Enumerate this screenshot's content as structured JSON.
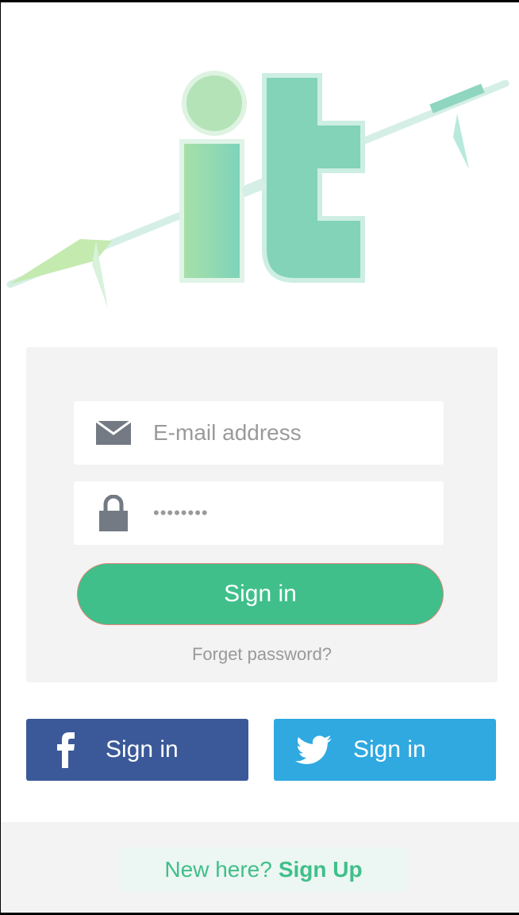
{
  "logo": {
    "text": "it"
  },
  "login": {
    "email_placeholder": "E-mail address",
    "password_value": "••••••••",
    "signin_label": "Sign in",
    "forgot_label": "Forget password?"
  },
  "social": {
    "facebook_label": "Sign in",
    "twitter_label": "Sign in"
  },
  "footer": {
    "prompt": "New here?",
    "signup_label": "Sign Up"
  },
  "colors": {
    "accent": "#40bf8a",
    "facebook": "#3b5998",
    "twitter": "#2fa9e0"
  }
}
